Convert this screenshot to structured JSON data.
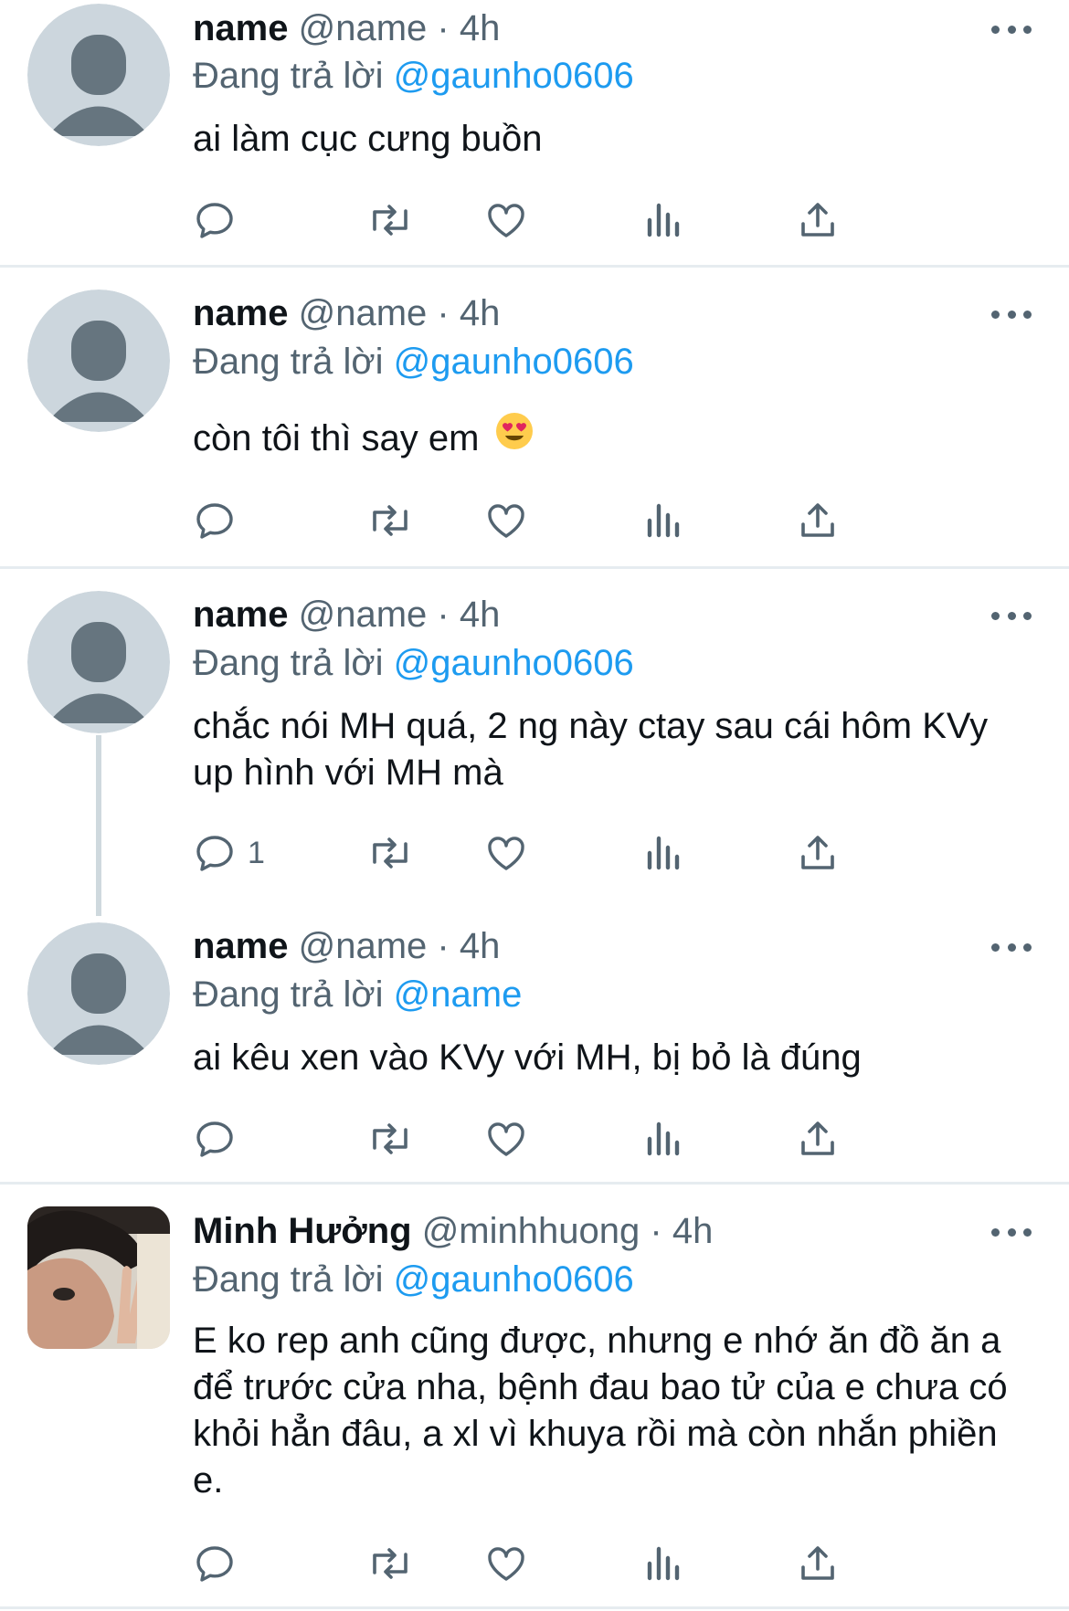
{
  "tweets": [
    {
      "name": "name",
      "handle": "@name",
      "time": "4h",
      "reply_prefix": "Đang trả lời",
      "reply_to": "@gaunho0606",
      "text": "ai làm cục cưng buồn",
      "reply_count": ""
    },
    {
      "name": "name",
      "handle": "@name",
      "time": "4h",
      "reply_prefix": "Đang trả lời",
      "reply_to": "@gaunho0606",
      "text": "còn tôi thì say em",
      "emoji": "smiling-face-with-heart-eyes",
      "reply_count": ""
    },
    {
      "name": "name",
      "handle": "@name",
      "time": "4h",
      "reply_prefix": "Đang trả lời",
      "reply_to": "@gaunho0606",
      "text": "chắc nói MH quá, 2 ng này ctay sau cái hôm KVy up hình với MH mà",
      "reply_count": "1"
    },
    {
      "name": "name",
      "handle": "@name",
      "time": "4h",
      "reply_prefix": "Đang trả lời",
      "reply_to": "@name",
      "text": "ai kêu xen vào KVy với MH, bị bỏ là đúng",
      "reply_count": ""
    },
    {
      "name": "Minh Hưởng",
      "handle": "@minhhuong",
      "time": "4h",
      "reply_prefix": "Đang trả lời",
      "reply_to": "@gaunho0606",
      "text": "E ko rep anh cũng được, nhưng e nhớ ăn đồ ăn a để trước cửa nha, bệnh đau bao tử của e chưa có khỏi hẳn đâu, a xl vì khuya rồi mà còn nhắn phiền e.",
      "reply_count": ""
    }
  ],
  "colors": {
    "accent": "#1d9bf0",
    "muted": "#536471",
    "divider": "#e6ecf0",
    "avatar_bg": "#ccd6dd",
    "avatar_fg": "#66757f"
  },
  "icons": [
    "reply-icon",
    "retweet-icon",
    "like-icon",
    "analytics-icon",
    "share-icon",
    "more-icon"
  ]
}
